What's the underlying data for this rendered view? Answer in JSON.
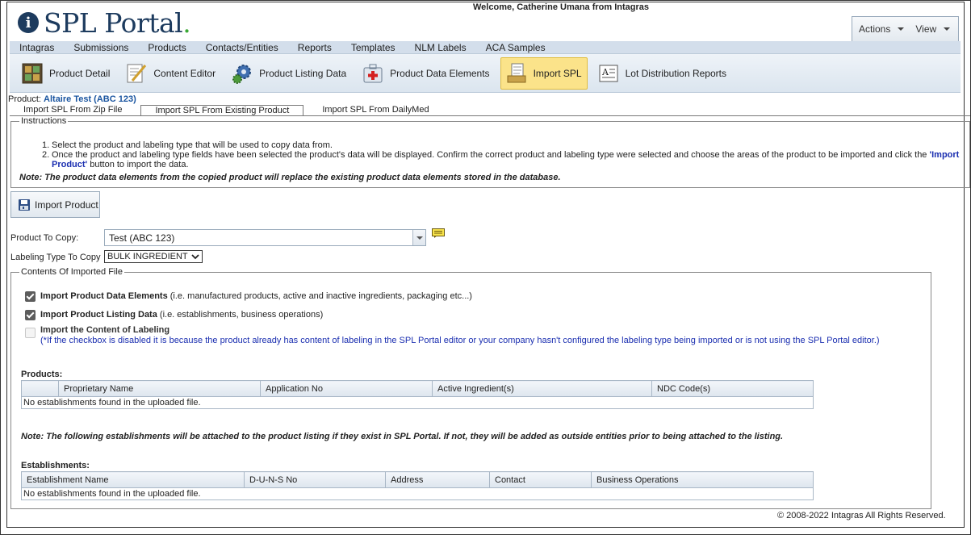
{
  "header": {
    "logo_text": "SPL Portal",
    "logo_letter": "i",
    "welcome": "Welcome, Catherine Umana from Intagras",
    "actions_label": "Actions",
    "view_label": "View"
  },
  "nav": {
    "items": [
      "Intagras",
      "Submissions",
      "Products",
      "Contacts/Entities",
      "Reports",
      "Templates",
      "NLM Labels",
      "ACA Samples"
    ]
  },
  "toolbar": {
    "items": [
      {
        "label": "Product Detail",
        "icon": "product-detail-icon"
      },
      {
        "label": "Content Editor",
        "icon": "content-editor-icon"
      },
      {
        "label": "Product Listing Data",
        "icon": "gear-icon"
      },
      {
        "label": "Product Data Elements",
        "icon": "medical-kit-icon"
      },
      {
        "label": "Import SPL",
        "icon": "import-spl-icon",
        "active": true
      },
      {
        "label": "Lot Distribution Reports",
        "icon": "document-icon"
      }
    ]
  },
  "product": {
    "label": "Product:",
    "value": "Altaire Test (ABC 123)"
  },
  "tabs": {
    "items": [
      "Import SPL From Zip File",
      "Import SPL From Existing Product",
      "Import SPL From DailyMed"
    ],
    "active_index": 1
  },
  "instructions": {
    "legend": "Instructions",
    "step1": "Select the product and labeling type that will be used to copy data from.",
    "step2_pre": "Once the product and labeling type fields have been selected the product's data will be displayed. Confirm the correct product and labeling type were selected and choose the areas of the product to be imported and click the ",
    "step2_link": "'Import Product'",
    "step2_post": " button to import the data.",
    "note": "Note: The product data elements from the copied product will replace the existing product data elements stored in the database."
  },
  "import_button": "Import Product",
  "form": {
    "product_to_copy_label": "Product To Copy:",
    "product_to_copy_value": "Test  (ABC 123)",
    "labeling_type_label": "Labeling Type To Copy",
    "labeling_type_value": "BULK INGREDIENT"
  },
  "contents": {
    "legend": "Contents Of Imported File",
    "options": [
      {
        "title": "Import Product Data Elements",
        "desc": " (i.e. manufactured products, active and inactive ingredients, packaging etc...)",
        "checked": true,
        "disabled": false
      },
      {
        "title": "Import Product Listing Data",
        "desc": " (i.e. establishments, business operations)",
        "checked": true,
        "disabled": false
      },
      {
        "title": "Import the Content of Labeling",
        "desc": "",
        "checked": false,
        "disabled": true
      }
    ],
    "labeling_help": "(*If the checkbox is disabled it is because the product already has content of labeling in the SPL Portal editor or your company hasn't configured the labeling type being imported or is not using the SPL Portal editor.)",
    "products_title": "Products:",
    "products_columns": [
      "",
      "Proprietary Name",
      "Application No",
      "Active Ingredient(s)",
      "NDC Code(s)"
    ],
    "products_empty": "No establishments found in the uploaded file.",
    "establishments_note": "Note: The following establishments will be attached to the product listing if they exist in SPL Portal. If not, they will be added as outside entities prior to being attached to the listing.",
    "establishments_title": "Establishments:",
    "establishments_columns": [
      "Establishment Name",
      "D-U-N-S No",
      "Address",
      "Contact",
      "Business Operations"
    ],
    "establishments_empty": "No establishments found in the uploaded file."
  },
  "footer": "© 2008-2022 Intagras All Rights Reserved."
}
